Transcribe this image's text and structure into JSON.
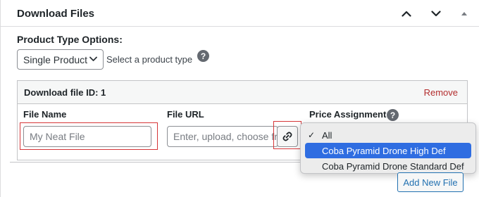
{
  "panel": {
    "title": "Download Files",
    "header_buttons": [
      "chevron-up-icon",
      "chevron-down-icon",
      "toggle-arrow-icon"
    ]
  },
  "product_type": {
    "label": "Product Type Options:",
    "selected": "Single Product",
    "hint": "Select a product type"
  },
  "file": {
    "id_label": "Download file ID: 1",
    "remove_label": "Remove",
    "columns": {
      "name": "File Name",
      "url": "File URL",
      "price": "Price Assignment"
    },
    "name_value": "My Neat File",
    "url_placeholder": "Enter, upload, choose fro"
  },
  "price_dropdown": {
    "options": [
      {
        "label": "All",
        "checked": true,
        "highlighted": false
      },
      {
        "label": "Coba Pyramid Drone High Def",
        "checked": false,
        "highlighted": true
      },
      {
        "label": "Coba Pyramid Drone Standard Def",
        "checked": false,
        "highlighted": false
      }
    ]
  },
  "add_new_file_label": "Add New File",
  "colors": {
    "accent": "#2271b1",
    "highlight": "#2f6de1",
    "danger": "#b32d2e",
    "annotation_red": "#d63638"
  }
}
